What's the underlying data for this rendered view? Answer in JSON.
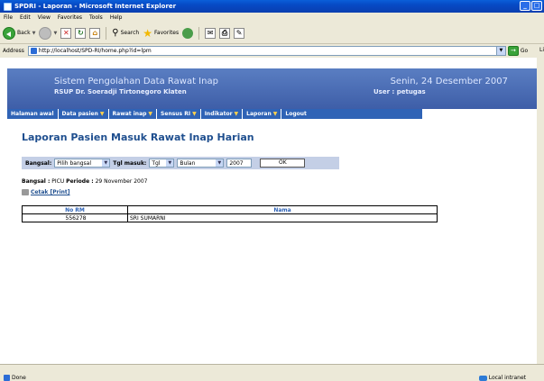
{
  "window": {
    "title": "SPDRI - Laporan - Microsoft Internet Explorer"
  },
  "menubar": [
    "File",
    "Edit",
    "View",
    "Favorites",
    "Tools",
    "Help"
  ],
  "toolbar": {
    "back": "Back",
    "search": "Search",
    "favorites": "Favorites"
  },
  "address": {
    "label": "Address",
    "url": "http://localhost/SPD-RI/home.php?id=lpm",
    "go": "Go",
    "links": "Li"
  },
  "header": {
    "system": "Sistem Pengolahan Data Rawat Inap",
    "hospital": "RSUP Dr. Soeradji Tirtonegoro Klaten",
    "date": "Senin, 24 Desember 2007",
    "user": "User : petugas"
  },
  "nav": [
    "Halaman awal",
    "Data pasien",
    "Rawat inap",
    "Sensus RI",
    "Indikator",
    "Laporan",
    "Logout"
  ],
  "report": {
    "title": "Laporan Pasien Masuk Rawat Inap Harian"
  },
  "filter": {
    "bangsal_label": "Bangsal:",
    "bangsal_value": "Pilih bangsal",
    "tgl_label": "Tgl masuk:",
    "tgl_value": "Tgl",
    "bulan_value": "Bulan",
    "year_value": "2007",
    "ok": "OK"
  },
  "meta": {
    "bangsal_label": "Bangsal :",
    "bangsal": "PICU",
    "periode_label": "Periode :",
    "periode": "29 November 2007"
  },
  "print": {
    "label": "Cetak [Print]"
  },
  "table": {
    "headers": [
      "No RM",
      "Nama"
    ],
    "rows": [
      [
        "556278",
        "SRI SUMARNI"
      ]
    ]
  },
  "status": {
    "left": "Done",
    "right": "Local intranet"
  }
}
